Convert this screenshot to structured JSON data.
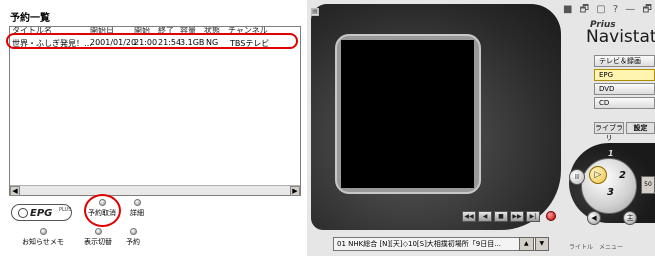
{
  "left_panel": {
    "title": "予約一覧",
    "columns": [
      "タイトル名",
      "開始日",
      "開始",
      "終了",
      "容量",
      "状態",
      "チャンネル"
    ],
    "rows": [
      {
        "title": "世界・ふしぎ発見！…",
        "date": "2001/01/20",
        "start": "21:00",
        "end": "21:54",
        "size": "3.1GB",
        "status": "NG",
        "channel": "TBSテレビ"
      }
    ],
    "scroll_left": "◀",
    "scroll_right": "▶",
    "logo_text": "EPG",
    "logo_plus": "PLUS",
    "buttons": {
      "cancel": "予約取消",
      "detail": "詳細",
      "notice": "お知らせメモ",
      "display_switch": "表示切替",
      "reserve": "予約"
    }
  },
  "player": {
    "window_buttons": "■ 🗗 ▢ ? — 🗗 ✕",
    "small_icon": "▤",
    "brand_small": "Prius",
    "brand_big": "Navistation",
    "menu": [
      "テレビ＆録画",
      "EPG",
      "DVD",
      "CD"
    ],
    "tabs": [
      "ライブラリ",
      "設定"
    ],
    "transport": [
      "◀◀",
      "◀",
      "■",
      "▶▶",
      "▶|"
    ],
    "status_text": "01 NHK総合 [N][天]◇10[S]大相撲初場所「9日目...",
    "updown": [
      "▲",
      "▼"
    ],
    "dial": {
      "pause": "II",
      "play": "▷",
      "n1": "1",
      "n2": "2",
      "n3": "3"
    },
    "volume": "50",
    "main_button": "主",
    "bottom_labels": [
      "ライトル",
      "メニュー"
    ]
  }
}
